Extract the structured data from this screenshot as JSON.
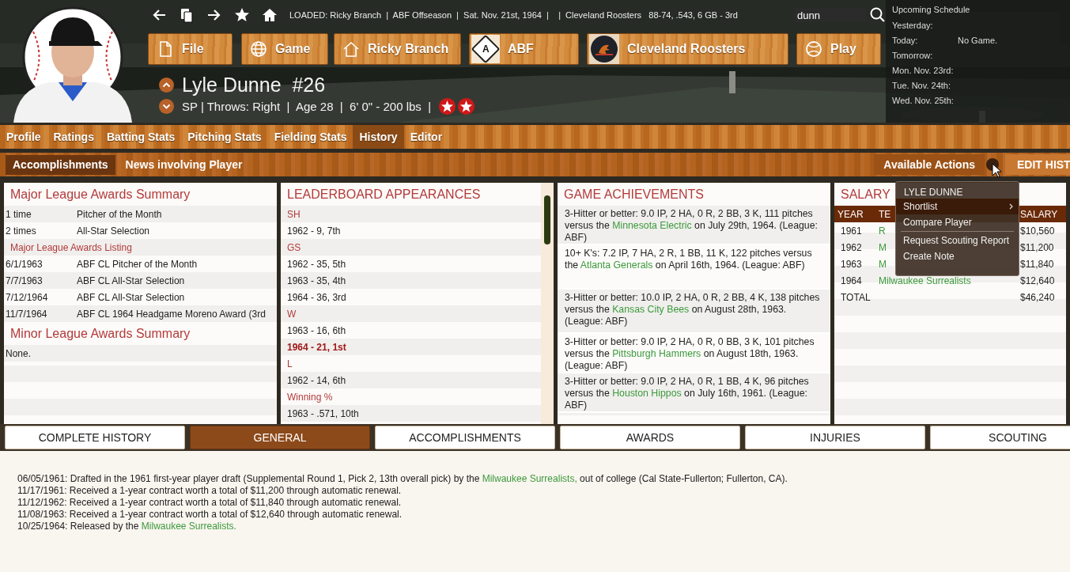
{
  "toolbar": {
    "status": "LOADED: Ricky Branch  |  ABF Offseason  |  Sat. Nov. 21st, 1964  |    |  Cleveland Roosters   88-74, .543, 6 GB - 3rd",
    "search": {
      "value": "dunn"
    }
  },
  "nav_buttons": [
    {
      "label": "File",
      "kind": "file"
    },
    {
      "label": "Game",
      "kind": "globe"
    },
    {
      "label": "Ricky Branch",
      "kind": "home"
    },
    {
      "label": "ABF",
      "kind": "league",
      "logo_text": "A"
    },
    {
      "label": "Cleveland Roosters",
      "kind": "team"
    },
    {
      "label": "Play",
      "kind": "ball"
    }
  ],
  "player": {
    "name": "Lyle Dunne",
    "number": "#26",
    "details": "SP | Throws: Right  |  Age 28  |  6' 0\" - 200 lbs  |",
    "badges": [
      {
        "kind": "all_star"
      },
      {
        "kind": "all_star"
      }
    ]
  },
  "schedule": {
    "title": "Upcoming Schedule",
    "rows": [
      {
        "label": "Yesterday:"
      },
      {
        "label": "Today:",
        "value": "No Game."
      },
      {
        "label": "Tomorrow:"
      },
      {
        "label": "Mon. Nov. 23rd:"
      },
      {
        "label": "Tue. Nov. 24th:"
      },
      {
        "label": "Wed. Nov. 25th:"
      }
    ]
  },
  "tabs": [
    {
      "label": "Profile",
      "selected": false
    },
    {
      "label": "Ratings",
      "selected": false
    },
    {
      "label": "Batting Stats",
      "selected": false
    },
    {
      "label": "Pitching Stats",
      "selected": false
    },
    {
      "label": "Fielding Stats",
      "selected": false
    },
    {
      "label": "History",
      "selected": true
    },
    {
      "label": "Editor",
      "selected": false
    }
  ],
  "subtabs": [
    {
      "label": "Accomplishments",
      "selected": true
    },
    {
      "label": "News involving Player",
      "selected": false
    }
  ],
  "actions": {
    "label": "Available Actions",
    "button": "EDIT HIST"
  },
  "awards": {
    "sections": [
      {
        "title": "Major League Awards Summary",
        "rows": [
          {
            "kind": "pair",
            "col1": "1 time",
            "col2": "Pitcher of the Month"
          },
          {
            "kind": "pair",
            "col1": "2 times",
            "col2": "All-Star Selection"
          },
          {
            "kind": "subheading",
            "text": "Major League Awards Listing"
          },
          {
            "kind": "pair",
            "col1": "6/1/1963",
            "col2": "ABF CL Pitcher of the Month"
          },
          {
            "kind": "pair",
            "col1": "7/7/1963",
            "col2": "ABF CL All-Star Selection"
          },
          {
            "kind": "pair",
            "col1": "7/12/1964",
            "col2": "ABF CL All-Star Selection"
          },
          {
            "kind": "pair",
            "col1": "11/7/1964",
            "col2": "ABF CL 1964 Headgame Moreno Award (3rd"
          }
        ]
      },
      {
        "title": "Minor League Awards Summary",
        "rows": [
          {
            "kind": "text",
            "text": "None."
          }
        ]
      }
    ]
  },
  "leaderboard": {
    "title": "LEADERBOARD APPEARANCES",
    "rows": [
      {
        "kind": "heading",
        "text": "SH"
      },
      {
        "kind": "entry",
        "text": "1962 - 9, 7th"
      },
      {
        "kind": "heading",
        "text": "GS"
      },
      {
        "kind": "entry",
        "text": "1962 - 35, 5th"
      },
      {
        "kind": "entry",
        "text": "1963 - 35, 4th"
      },
      {
        "kind": "entry",
        "text": "1964 - 36, 3rd"
      },
      {
        "kind": "heading",
        "text": "W"
      },
      {
        "kind": "entry",
        "text": "1963 - 16, 6th"
      },
      {
        "kind": "leader",
        "text": "1964 - 21, 1st"
      },
      {
        "kind": "heading",
        "text": "L"
      },
      {
        "kind": "entry",
        "text": "1962 - 14, 6th"
      },
      {
        "kind": "heading",
        "text": "Winning %"
      },
      {
        "kind": "entry",
        "text": "1963 - .571, 10th"
      }
    ]
  },
  "achievements": {
    "title": "GAME ACHIEVEMENTS",
    "entries": [
      {
        "parts": [
          {
            "text": "3-Hitter or better: 9.0 IP, 2 HA, 0 R, 2 BB, 3 K, 111 pitches versus the "
          },
          {
            "text": "Minnesota Electric",
            "link": true
          },
          {
            "text": " on July 29th, 1964. (League: ABF)"
          }
        ]
      },
      {
        "parts": [
          {
            "text": "10+ K's: 7.2 IP, 7 HA, 2 R, 1 BB, 11 K, 122 pitches versus the "
          },
          {
            "text": "Atlanta Generals",
            "link": true
          },
          {
            "text": " on April 16th, 1964. (League: ABF)"
          }
        ]
      },
      {
        "parts": [
          {
            "text": "3-Hitter or better: 10.0 IP, 2 HA, 0 R, 2 BB, 4 K, 138 pitches versus the "
          },
          {
            "text": "Kansas City Bees",
            "link": true
          },
          {
            "text": " on August 28th, 1963. (League: ABF)"
          }
        ]
      },
      {
        "parts": [
          {
            "text": "3-Hitter or better: 9.0 IP, 2 HA, 0 R, 0 BB, 3 K, 101 pitches versus the "
          },
          {
            "text": "Pittsburgh Hammers",
            "link": true
          },
          {
            "text": " on August 18th, 1963. (League: ABF)"
          }
        ]
      },
      {
        "parts": [
          {
            "text": "3-Hitter or better: 9.0 IP, 2 HA, 0 R, 1 BB, 4 K, 96 pitches versus the "
          },
          {
            "text": "Houston Hippos",
            "link": true
          },
          {
            "text": " on July 16th, 1961. (League: ABF)"
          }
        ]
      }
    ]
  },
  "salary": {
    "title": "SALARY",
    "columns": [
      "YEAR",
      "TE",
      "SALARY"
    ],
    "rows": [
      {
        "kind": "year",
        "year": "1961",
        "team": "R",
        "salary": "$10,560"
      },
      {
        "kind": "year",
        "year": "1962",
        "team": "M",
        "salary": "$11,200"
      },
      {
        "kind": "year",
        "year": "1963",
        "team": "M",
        "salary": "$11,840"
      },
      {
        "kind": "year",
        "year": "1964",
        "team": "Milwaukee Surrealists",
        "salary": "$12,640"
      },
      {
        "kind": "total",
        "year": "TOTAL",
        "salary": "$46,240"
      }
    ]
  },
  "context_menu": {
    "title": "LYLE DUNNE",
    "items": [
      {
        "kind": "item",
        "label": "Shortlist",
        "submenu": true,
        "selected": true
      },
      {
        "kind": "item",
        "label": "Compare Player",
        "submenu": false,
        "selected": false
      },
      {
        "kind": "separator"
      },
      {
        "kind": "item",
        "label": "Request Scouting Report",
        "submenu": false,
        "selected": false
      },
      {
        "kind": "item",
        "label": "Create Note",
        "submenu": false,
        "selected": false
      }
    ]
  },
  "bottom_tabs": [
    {
      "label": "COMPLETE HISTORY",
      "selected": false
    },
    {
      "label": "GENERAL",
      "selected": true
    },
    {
      "label": "ACCOMPLISHMENTS",
      "selected": false
    },
    {
      "label": "AWARDS",
      "selected": false
    },
    {
      "label": "INJURIES",
      "selected": false
    },
    {
      "label": "SCOUTING",
      "selected": false
    }
  ],
  "history_log": [
    {
      "parts": [
        {
          "text": "06/05/1961: Drafted in the 1961 first-year player draft (Supplemental Round 1,  Pick 2, 13th overall pick) by the "
        },
        {
          "text": "Milwaukee Surrealists,",
          "link": true
        },
        {
          "text": " out of college (Cal State-Fullerton; Fullerton, CA)."
        }
      ]
    },
    {
      "parts": [
        {
          "text": "11/17/1961: Received a 1-year contract worth a total of $11,200 through automatic renewal."
        }
      ]
    },
    {
      "parts": [
        {
          "text": "11/12/1962: Received a 1-year contract worth a total of $11,840 through automatic renewal."
        }
      ]
    },
    {
      "parts": [
        {
          "text": "11/08/1963: Received a 1-year contract worth a total of $12,640 through automatic renewal."
        }
      ]
    },
    {
      "parts": [
        {
          "text": "10/25/1964: Released by the "
        },
        {
          "text": "Milwaukee Surrealists.",
          "link": true
        }
      ]
    }
  ]
}
